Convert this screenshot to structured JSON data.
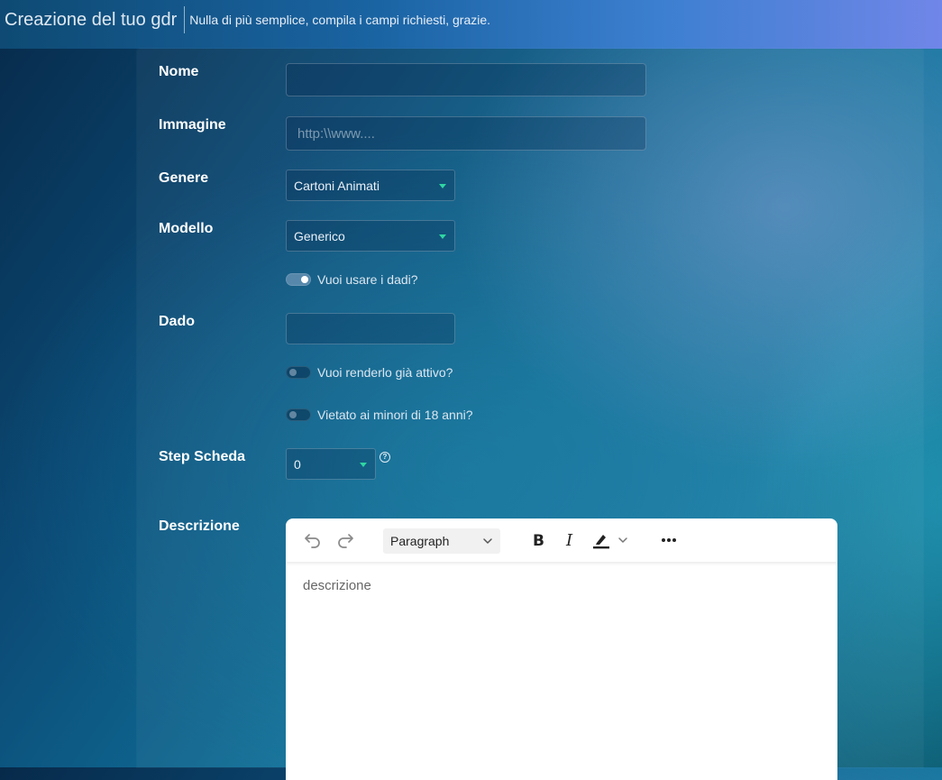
{
  "header": {
    "title": "Creazione del tuo gdr",
    "subtitle": "Nulla di più semplice, compila i campi richiesti, grazie."
  },
  "form": {
    "nome": {
      "label": "Nome",
      "value": ""
    },
    "immagine": {
      "label": "Immagine",
      "placeholder": "http:\\\\www...."
    },
    "genere": {
      "label": "Genere",
      "selected": "Cartoni Animati"
    },
    "modello": {
      "label": "Modello",
      "selected": "Generico"
    },
    "usa_dadi": {
      "label": "Vuoi usare i dadi?",
      "checked": true
    },
    "dado": {
      "label": "Dado",
      "value": ""
    },
    "attivo": {
      "label": "Vuoi renderlo già attivo?",
      "checked": false
    },
    "vietato": {
      "label": "Vietato ai minori di 18 anni?",
      "checked": false
    },
    "step_scheda": {
      "label": "Step Scheda",
      "selected": "0"
    },
    "descrizione": {
      "label": "Descrizione",
      "placeholder": "descrizione"
    }
  },
  "editor": {
    "paragraph_label": "Paragraph",
    "icons": [
      "undo-icon",
      "redo-icon",
      "chevron-down-icon",
      "bold-icon",
      "italic-icon",
      "highlight-icon",
      "more-icon"
    ]
  },
  "colors": {
    "caret_accent": "#2fd6a2",
    "editor_bg": "#ffffff"
  }
}
